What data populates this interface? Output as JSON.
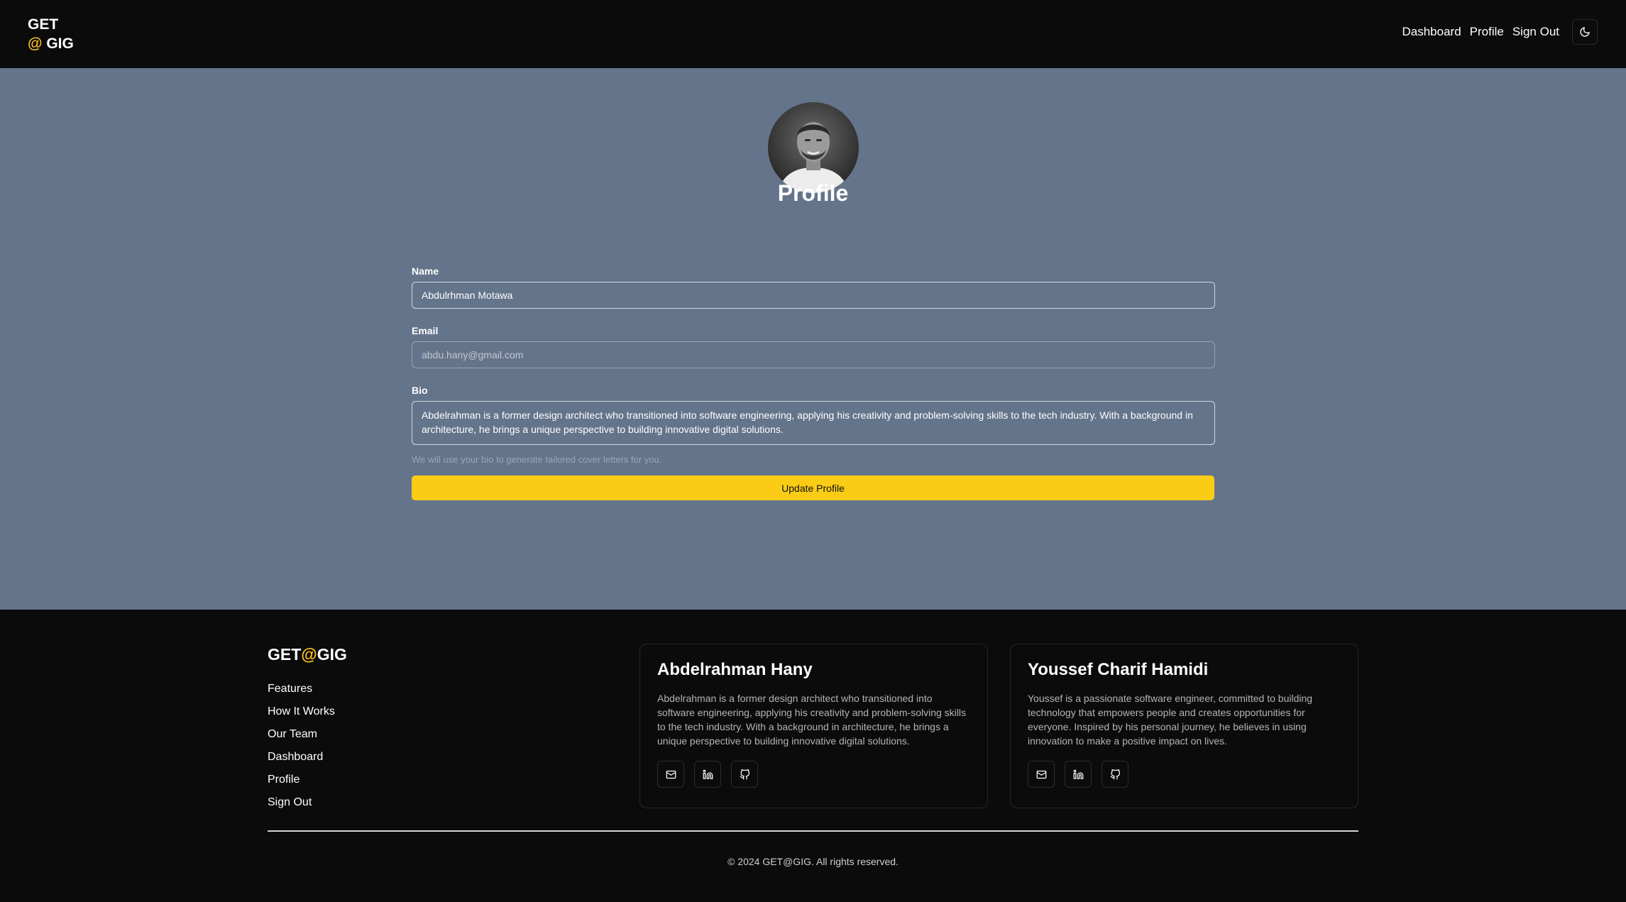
{
  "header": {
    "logo_line1": "GET",
    "logo_at": "@",
    "logo_line2": " GIG",
    "nav": {
      "dashboard": "Dashboard",
      "profile": "Profile",
      "sign_out": "Sign Out"
    },
    "theme_icon": "moon-icon"
  },
  "profile": {
    "avatar_icon": "avatar",
    "title": "Profile",
    "name_label": "Name",
    "name_value": "Abdulrhman Motawa",
    "email_label": "Email",
    "email_value": "abdu.hany@gmail.com",
    "bio_label": "Bio",
    "bio_value": "Abdelrahman is a former design architect who transitioned into software engineering, applying his creativity and problem-solving skills to the tech industry. With a background in architecture, he brings a unique perspective to building innovative digital solutions.",
    "bio_hint": "We will use your bio to generate tailored cover letters for you.",
    "update_button": "Update Profile"
  },
  "footer": {
    "logo_get": "GET",
    "logo_at": "@",
    "logo_gig": "GIG",
    "links": [
      "Features",
      "How It Works",
      "Our Team",
      "Dashboard",
      "Profile",
      "Sign Out"
    ],
    "team": [
      {
        "name": "Abdelrahman Hany",
        "bio": "Abdelrahman is a former design architect who transitioned into software engineering, applying his creativity and problem-solving skills to the tech industry. With a background in architecture, he brings a unique perspective to building innovative digital solutions."
      },
      {
        "name": "Youssef Charif Hamidi",
        "bio": "Youssef is a passionate software engineer, committed to building technology that empowers people and creates opportunities for everyone. Inspired by his personal journey, he believes in using innovation to make a positive impact on lives."
      }
    ],
    "social_icons": [
      "mail-icon",
      "linkedin-icon",
      "github-icon"
    ],
    "copyright": "© 2024 GET@GIG. All rights reserved."
  },
  "colors": {
    "accent": "#facc15",
    "logo_at": "#fbbf24",
    "main_bg": "#64748b",
    "dark_bg": "#0b0b0b"
  }
}
